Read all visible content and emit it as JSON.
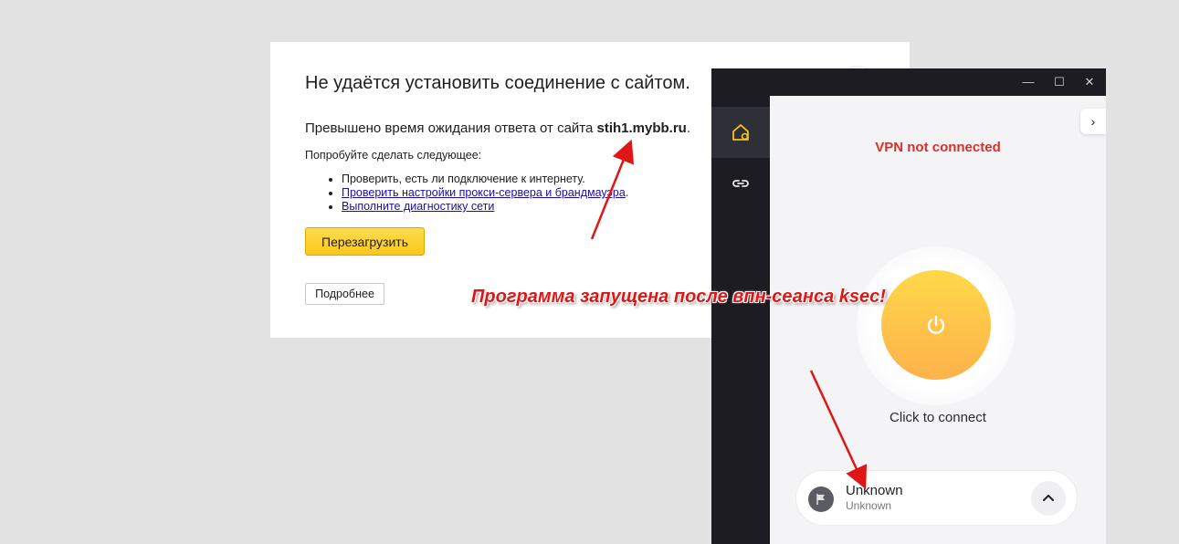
{
  "error_page": {
    "title": "Не удаётся установить соединение с сайтом.",
    "message_prefix": "Превышено время ожидания ответа от сайта ",
    "message_site": "stih1.mybb.ru",
    "message_suffix": ".",
    "try_label": "Попробуйте сделать следующее:",
    "suggestions": [
      "Проверить, есть ли подключение к интернету.",
      "Проверить настройки прокси-сервера и брандмауэра",
      "Выполните диагностику сети"
    ],
    "suggestion_2_suffix": ".",
    "reload_button": "Перезагрузить",
    "details_button": "Подробнее"
  },
  "vpn": {
    "window_controls": [
      "—",
      "☐",
      "✕"
    ],
    "status": "VPN not connected",
    "connect_hint": "Click to connect",
    "expand_icon": "›",
    "location": {
      "name": "Unknown",
      "sub": "Unknown"
    },
    "sidebar": [
      "home-icon",
      "link-icon"
    ],
    "colors": {
      "status": "#d93025",
      "power_top": "#ffd84a",
      "power_bottom": "#fdb24a",
      "sidebar": "#1c1c22"
    }
  },
  "annotation": {
    "text": "Программа запущена после впн-сеанса ksec!",
    "color": "#e01616"
  }
}
